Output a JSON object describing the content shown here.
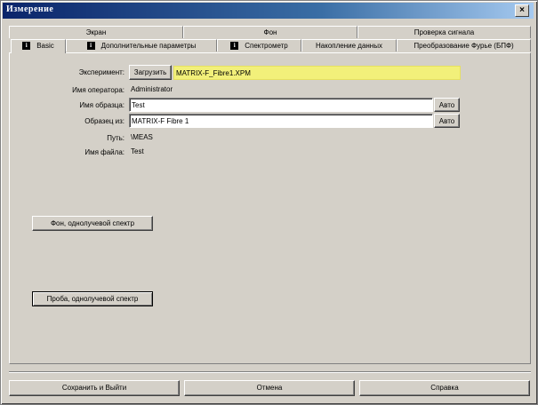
{
  "window": {
    "title": "Измерение"
  },
  "tabs_row1": [
    "Экран",
    "Фон",
    "Проверка сигнала"
  ],
  "tabs_row2": [
    {
      "label": "Basic",
      "icon": "info-icon"
    },
    {
      "label": "Дополнительные параметры",
      "icon": "info-icon"
    },
    {
      "label": "Спектрометр",
      "icon": "info-icon"
    },
    {
      "label": "Накопление данных"
    },
    {
      "label": "Преобразование Фурье (БПФ)"
    }
  ],
  "form": {
    "experiment_label": "Эксперимент:",
    "load_button": "Загрузить",
    "experiment_value": "MATRIX-F_Fibre1.XPM",
    "operator_label": "Имя оператора:",
    "operator_value": "Administrator",
    "sample_name_label": "Имя образца:",
    "sample_name_value": "Test",
    "sample_from_label": "Образец из:",
    "sample_from_value": "MATRIX-F Fibre 1",
    "auto_button": "Авто",
    "path_label": "Путь:",
    "path_value": "\\MEAS",
    "filename_label": "Имя файла:",
    "filename_value": "Test"
  },
  "actions": {
    "background_button": "Фон, однолучевой спектр",
    "sample_button": "Проба, однолучевой спектр"
  },
  "footer": {
    "save_exit": "Сохранить и Выйти",
    "cancel": "Отмена",
    "help": "Справка"
  },
  "colors": {
    "title_bar": "#0a246a",
    "experiment_field": "#f2f07a",
    "window_bg": "#d4d0c8"
  }
}
